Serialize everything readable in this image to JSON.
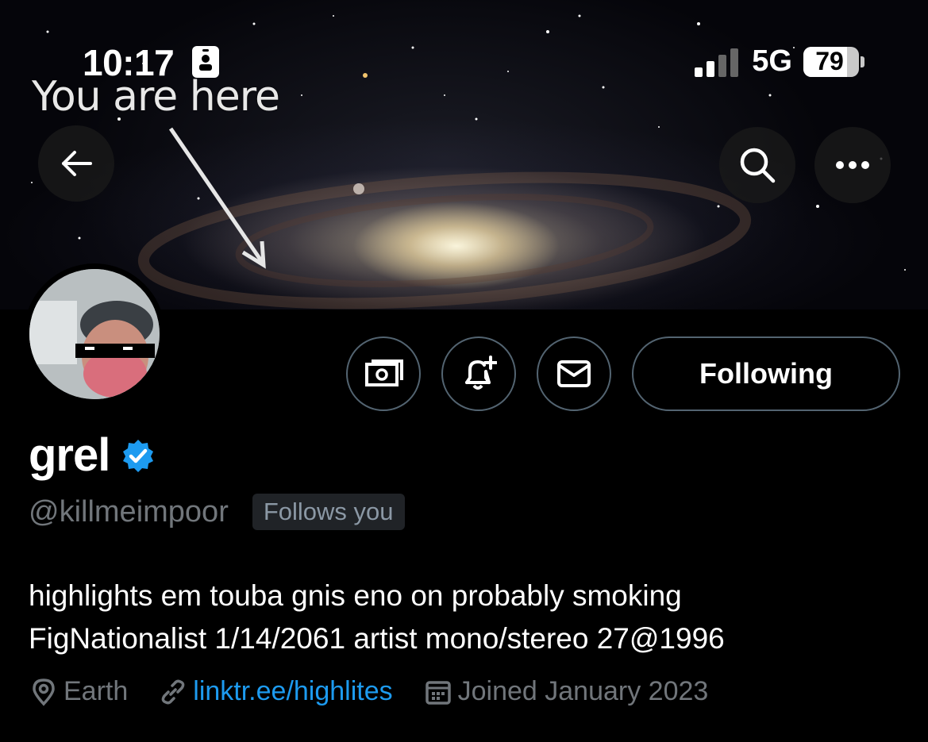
{
  "status_bar": {
    "time": "10:17",
    "network": "5G",
    "battery": "79",
    "battery_level": 0.79
  },
  "banner": {
    "caption": "You are here"
  },
  "header_buttons": {
    "back_icon": "arrow-left-icon",
    "search_icon": "search-icon",
    "more_icon": "more-horizontal-icon"
  },
  "actions": {
    "subscribe_icon": "money-icon",
    "notify_icon": "bell-plus-icon",
    "message_icon": "envelope-icon",
    "following_label": "Following"
  },
  "profile": {
    "name": "grel",
    "verified": true,
    "handle": "@killmeimpoor",
    "follows_you": "Follows you",
    "bio_line1": "highlights em touba gnis eno on probably smoking",
    "bio_line2": "FigNationalist 1/14/2061 artist mono/stereo 27@1996",
    "location": "Earth",
    "link": "linktr.ee/highlites",
    "joined": "Joined January 2023"
  },
  "colors": {
    "accent": "#1d9bf0",
    "verified": "#1d9bf0",
    "muted_text": "#71767b",
    "background": "#000000"
  }
}
